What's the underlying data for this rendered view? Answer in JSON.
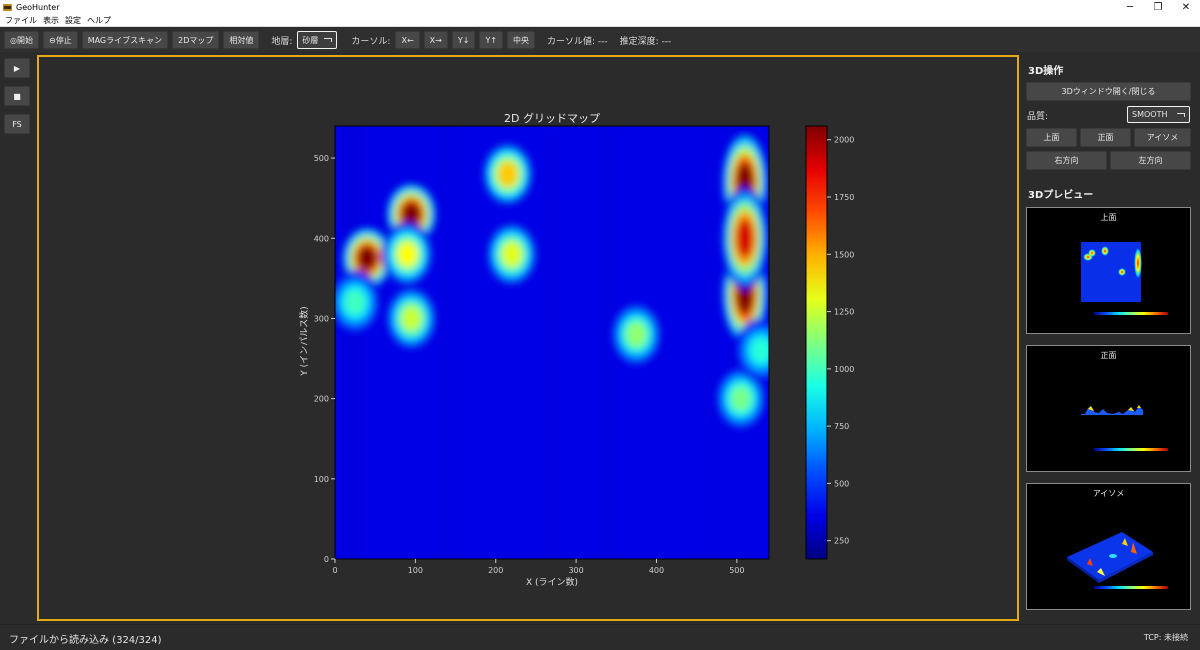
{
  "window": {
    "title": "GeoHunter",
    "minimize_glyph": "─",
    "maximize_glyph": "❐",
    "close_glyph": "✕"
  },
  "menu": [
    "ファイル",
    "表示",
    "設定",
    "ヘルプ"
  ],
  "toolbar": {
    "start_label": "◎開始",
    "stop_label": "⊖停止",
    "mag_label": "MAGライブスキャン",
    "map2d_label": "2Dマップ",
    "relative_label": "相対値",
    "layer_label": "地層:",
    "layer_value": "砂層",
    "cursor_label": "カーソル:",
    "x_minus": "X←",
    "x_plus": "X→",
    "y_down": "Y↓",
    "y_up": "Y↑",
    "center_label": "中央",
    "cursor_value": "カーソル値: ---",
    "depth_value": "推定深度: ---"
  },
  "left_tools": [
    "▶",
    "■",
    "FS"
  ],
  "chart_data": {
    "type": "heatmap",
    "title": "2D グリッドマップ",
    "xlabel": "X (ライン数)",
    "ylabel": "Y (インパルス数)",
    "xlim": [
      0,
      540
    ],
    "ylim": [
      0,
      540
    ],
    "xticks": [
      0,
      100,
      200,
      300,
      400,
      500
    ],
    "yticks": [
      0,
      100,
      200,
      300,
      400,
      500
    ],
    "colorbar_range": [
      170,
      2060
    ],
    "colorbar_ticks": [
      250,
      500,
      750,
      1000,
      1250,
      1500,
      1750,
      2000
    ],
    "colormap": "jet",
    "background_value": 360,
    "hotspots": [
      {
        "x": 40,
        "y": 375,
        "value": 2060
      },
      {
        "x": 95,
        "y": 430,
        "value": 2060
      },
      {
        "x": 90,
        "y": 380,
        "value": 1350
      },
      {
        "x": 95,
        "y": 300,
        "value": 1250
      },
      {
        "x": 25,
        "y": 320,
        "value": 1000
      },
      {
        "x": 215,
        "y": 480,
        "value": 1450
      },
      {
        "x": 220,
        "y": 380,
        "value": 1300
      },
      {
        "x": 375,
        "y": 280,
        "value": 1150
      },
      {
        "x": 510,
        "y": 470,
        "value": 2060
      },
      {
        "x": 510,
        "y": 330,
        "value": 2060
      },
      {
        "x": 510,
        "y": 400,
        "value": 1900
      },
      {
        "x": 505,
        "y": 200,
        "value": 1100
      },
      {
        "x": 530,
        "y": 260,
        "value": 950
      }
    ]
  },
  "right_panel": {
    "ops_title": "3D操作",
    "toggle_3d_label": "3Dウィンドウ開く/閉じる",
    "quality_label": "品質:",
    "quality_value": "SMOOTH",
    "view_top": "上面",
    "view_front": "正面",
    "view_iso": "アイソメ",
    "view_right": "右方向",
    "view_left": "左方向",
    "preview_title": "3Dプレビュー",
    "previews": [
      "上面",
      "正面",
      "アイソメ"
    ]
  },
  "status": {
    "message": "ファイルから読み込み (324/324)",
    "tcp": "TCP: 未接続"
  },
  "colors": {
    "accent_border": "#e6a817",
    "background": "#2b2b2b",
    "button": "#474747"
  }
}
